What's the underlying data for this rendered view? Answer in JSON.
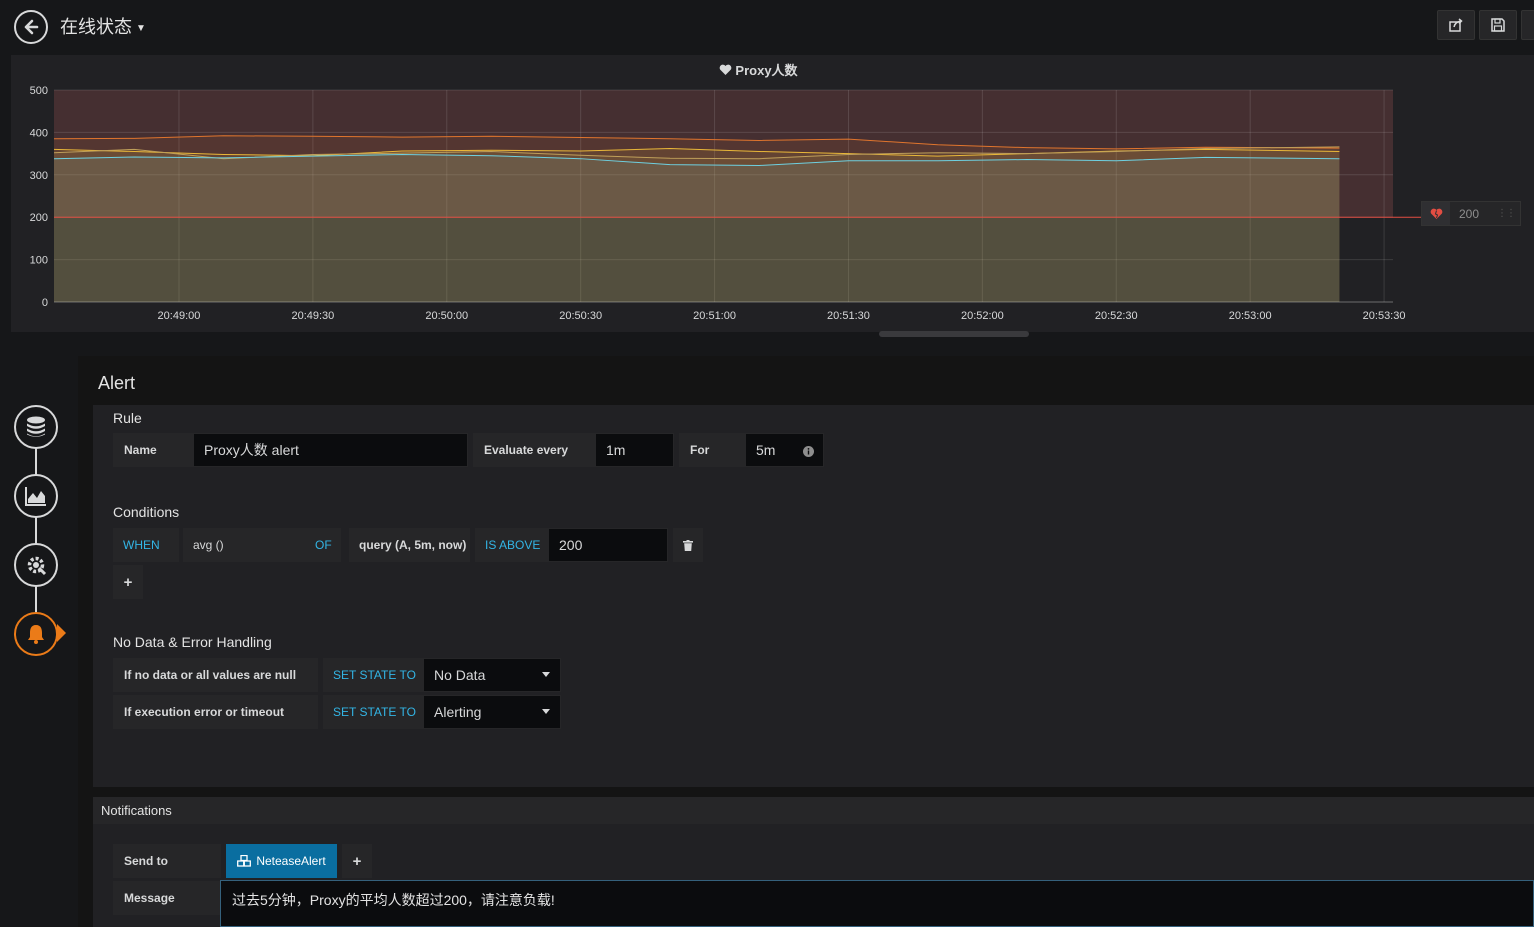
{
  "header": {
    "title": "在线状态",
    "buttons": [
      "share-icon",
      "save-icon"
    ]
  },
  "panel": {
    "title": "Proxy人数",
    "threshold_handle_value": "200"
  },
  "chart_data": {
    "type": "line",
    "title": "Proxy人数",
    "y_ticks": [
      "500",
      "400",
      "300",
      "200",
      "100",
      "0"
    ],
    "ylim": [
      0,
      500
    ],
    "x_tick_labels": [
      "20:49:00",
      "20:49:30",
      "20:50:00",
      "20:50:30",
      "20:51:00",
      "20:51:30",
      "20:52:00",
      "20:52:30",
      "20:53:00",
      "20:53:30"
    ],
    "x_tick_seconds": [
      0,
      30,
      60,
      90,
      120,
      150,
      180,
      210,
      240,
      270
    ],
    "xlim": [
      -28,
      272
    ],
    "data_end_seconds": 260,
    "threshold": 200,
    "series": [
      {
        "color": "#e0752d",
        "x": [
          -28,
          -10,
          10,
          30,
          50,
          70,
          90,
          110,
          130,
          150,
          170,
          190,
          210,
          230,
          260
        ],
        "values": [
          385,
          386,
          392,
          391,
          389,
          391,
          388,
          385,
          381,
          384,
          371,
          364,
          361,
          365,
          363
        ]
      },
      {
        "color": "#eab839",
        "x": [
          -28,
          -10,
          10,
          30,
          50,
          70,
          90,
          110,
          130,
          150,
          170,
          190,
          210,
          230,
          260
        ],
        "values": [
          360,
          355,
          348,
          345,
          356,
          358,
          356,
          362,
          355,
          350,
          344,
          350,
          356,
          360,
          355
        ]
      },
      {
        "color": "#bf9f5a",
        "x": [
          -28,
          -10,
          10,
          30,
          50,
          70,
          90,
          110,
          130,
          150,
          170,
          190,
          210,
          230,
          260
        ],
        "values": [
          352,
          360,
          338,
          348,
          351,
          355,
          346,
          339,
          338,
          348,
          352,
          350,
          355,
          362,
          366
        ]
      },
      {
        "color": "#6ed0e0",
        "x": [
          -28,
          -10,
          10,
          30,
          50,
          70,
          90,
          110,
          130,
          150,
          170,
          190,
          210,
          230,
          260
        ],
        "values": [
          338,
          342,
          340,
          344,
          348,
          345,
          338,
          324,
          322,
          333,
          333,
          336,
          333,
          341,
          338
        ]
      }
    ],
    "grid": true
  },
  "sidenav": {
    "items": [
      "database-icon",
      "chart-area-icon",
      "gear-icon",
      "bell-icon"
    ]
  },
  "alert": {
    "heading": "Alert",
    "rule": {
      "section_label": "Rule",
      "name_label": "Name",
      "name_value": "Proxy人数 alert",
      "evaluate_label": "Evaluate every",
      "evaluate_value": "1m",
      "for_label": "For",
      "for_value": "5m"
    },
    "conditions": {
      "section_label": "Conditions",
      "when": "WHEN",
      "reducer": "avg ()",
      "of": "OF",
      "query": "query (A, 5m, now)",
      "evaluator": "IS ABOVE",
      "threshold": "200"
    },
    "nodata": {
      "section_label": "No Data & Error Handling",
      "row1_label": "If no data or all values are null",
      "row1_kw": "SET STATE TO",
      "row1_value": "No Data",
      "row2_label": "If execution error or timeout",
      "row2_kw": "SET STATE TO",
      "row2_value": "Alerting"
    },
    "notifications": {
      "header": "Notifications",
      "send_to_label": "Send to",
      "channel": "NeteaseAlert",
      "message_label": "Message",
      "message_value": "过去5分钟，Proxy的平均人数超过200，请注意负载!"
    }
  },
  "colors": {
    "accent_blue": "#33b5e5",
    "threshold_red": "#e24d42",
    "active_orange": "#eb7b18",
    "chip_blue": "#0a6ea0"
  }
}
